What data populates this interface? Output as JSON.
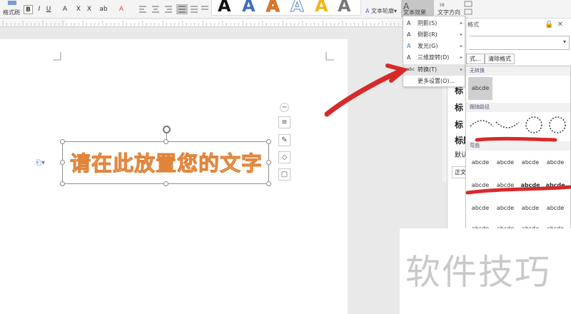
{
  "toolbar": {
    "format_painter": "格式刷",
    "bold": "B",
    "italic": "I",
    "underline": "U",
    "font_color": "A",
    "superscript": "X",
    "subscript": "X",
    "highlight": "ab",
    "text_fill": "A",
    "art_styles": [
      "A",
      "A",
      "A",
      "A",
      "A",
      "A"
    ],
    "art_style_colors": [
      "#111111",
      "#3f6fbf",
      "#e07a2e",
      "#7fa6dc",
      "#f2b417",
      "#777777"
    ],
    "text_outline": "文本轮廓",
    "text_effect": "文本效果",
    "text_direction": "文字方向"
  },
  "effects_menu": {
    "items": [
      {
        "label": "阴影(S)",
        "icon": "shadow-icon"
      },
      {
        "label": "倒影(R)",
        "icon": "reflection-icon"
      },
      {
        "label": "发光(G)",
        "icon": "glow-icon"
      },
      {
        "label": "三维旋转(D)",
        "icon": "3d-rotate-icon"
      },
      {
        "label": "转换(T)",
        "icon": "abc-transform-icon"
      },
      {
        "label": "更多设置(O)..."
      }
    ]
  },
  "transform_menu": {
    "no_transform": "无转换",
    "follow_path": "跟随路径",
    "warp": "弯曲",
    "tile_text": "abcde"
  },
  "document": {
    "art_text": "请在此放置您的文字"
  },
  "pane": {
    "header": "格式",
    "more_btn": "式...",
    "clear_format": "清除格式",
    "list_items": [
      "标",
      "标",
      "标",
      "标题"
    ],
    "default_label": "默认",
    "body_label": "正文"
  },
  "watermark": "软件技巧",
  "colors": {
    "accent_red": "#d62a2a",
    "art_text_fill": "#f7d8b4",
    "art_text_stroke": "#e0843a"
  }
}
